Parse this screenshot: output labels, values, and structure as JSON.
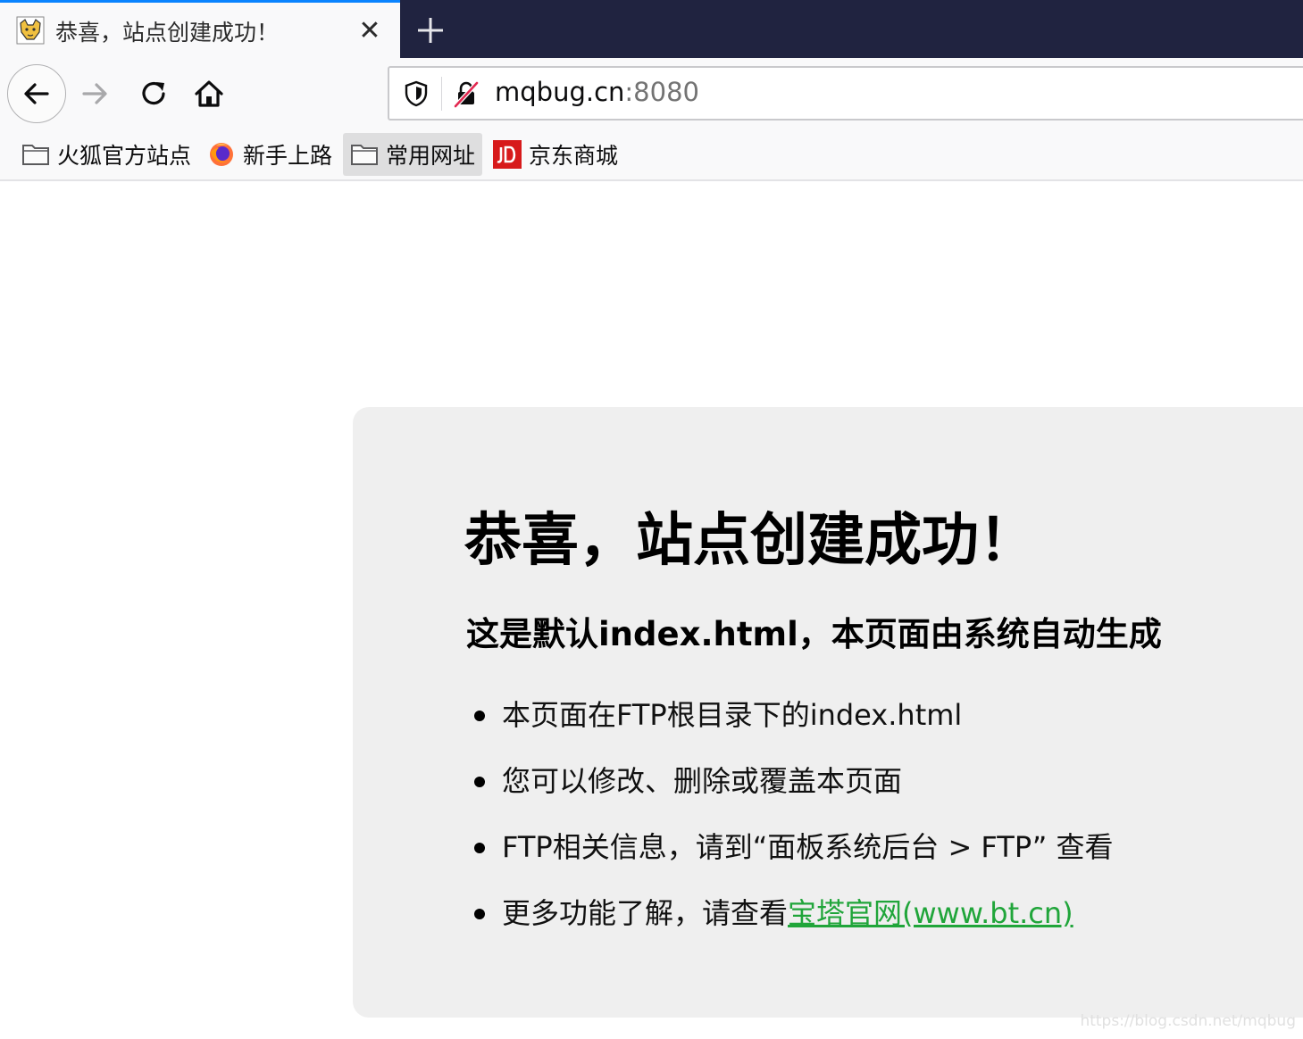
{
  "tab": {
    "title": "恭喜，站点创建成功！",
    "close_icon": "close-icon",
    "favicon": "tomcat-favicon"
  },
  "new_tab_icon": "plus-icon",
  "nav": {
    "back_icon": "arrow-left-icon",
    "forward_icon": "arrow-right-icon",
    "reload_icon": "reload-icon",
    "home_icon": "home-icon"
  },
  "urlbar": {
    "host": "mqbug.cn",
    "port": ":8080",
    "shield_icon": "tracking-protection-shield-icon",
    "lock_icon": "insecure-lock-icon"
  },
  "bookmarks": [
    {
      "label": "火狐官方站点",
      "icon": "folder-icon"
    },
    {
      "label": "新手上路",
      "icon": "firefox-icon"
    },
    {
      "label": "常用网址",
      "icon": "folder-icon"
    },
    {
      "label": "京东商城",
      "icon": "jd-icon"
    }
  ],
  "page": {
    "heading": "恭喜，站点创建成功！",
    "subheading": "这是默认index.html，本页面由系统自动生成",
    "items": [
      "本页面在FTP根目录下的index.html",
      "您可以修改、删除或覆盖本页面",
      "FTP相关信息，请到“面板系统后台 > FTP” 查看"
    ],
    "last_item_prefix": "更多功能了解，请查看",
    "last_item_link": "宝塔官网(www.bt.cn)",
    "link_color": "#20a53a"
  },
  "watermark": "https://blog.csdn.net/mqbug"
}
